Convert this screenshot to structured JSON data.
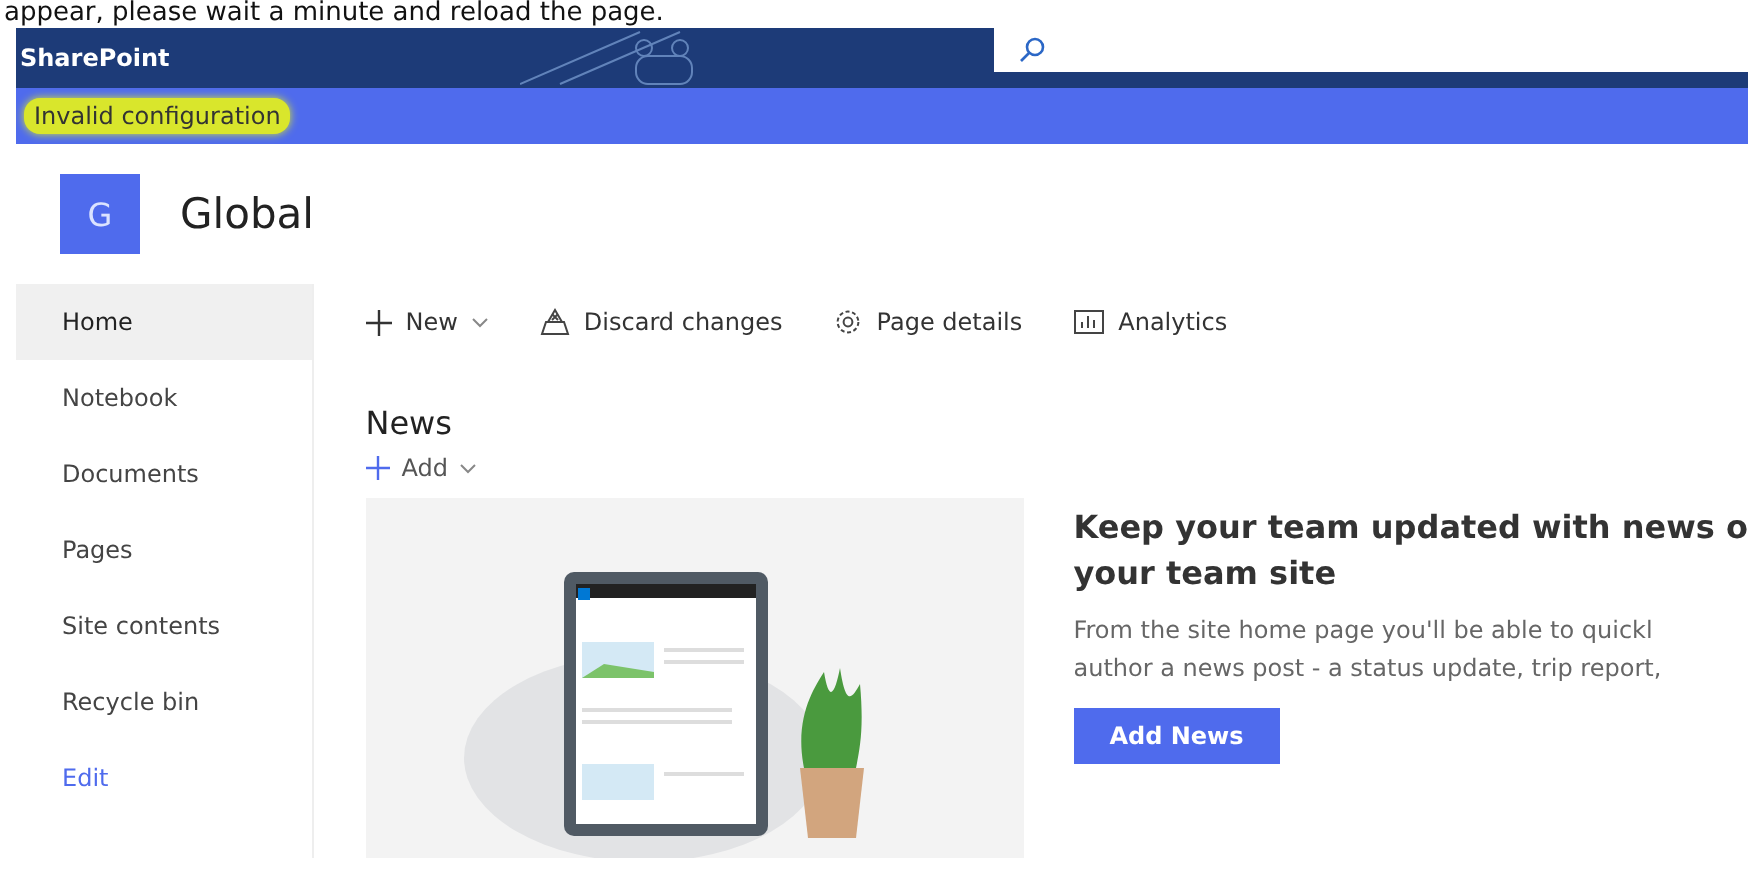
{
  "notice_text": "appear, please wait a minute and reload the page.",
  "suite_bar": {
    "app_name": "SharePoint"
  },
  "banner": {
    "message": "Invalid configuration"
  },
  "site": {
    "logo_letter": "G",
    "title": "Global"
  },
  "nav": [
    {
      "label": "Home",
      "selected": true,
      "kind": "item"
    },
    {
      "label": "Notebook",
      "selected": false,
      "kind": "item"
    },
    {
      "label": "Documents",
      "selected": false,
      "kind": "item"
    },
    {
      "label": "Pages",
      "selected": false,
      "kind": "item"
    },
    {
      "label": "Site contents",
      "selected": false,
      "kind": "item"
    },
    {
      "label": "Recycle bin",
      "selected": false,
      "kind": "item"
    },
    {
      "label": "Edit",
      "selected": false,
      "kind": "link"
    }
  ],
  "command_bar": [
    {
      "label": "New",
      "kind": "plus",
      "dropdown": true
    },
    {
      "label": "Discard changes",
      "kind": "discard",
      "dropdown": false
    },
    {
      "label": "Page details",
      "kind": "gear",
      "dropdown": false
    },
    {
      "label": "Analytics",
      "kind": "chart",
      "dropdown": false
    }
  ],
  "news": {
    "title": "News",
    "add_label": "Add",
    "heading_lines": [
      "Keep your team updated with news o",
      "your team site"
    ],
    "description_lines": [
      "From the site home page you'll be able to quickl",
      "author a news post - a status update, trip report,"
    ],
    "button": "Add News"
  }
}
